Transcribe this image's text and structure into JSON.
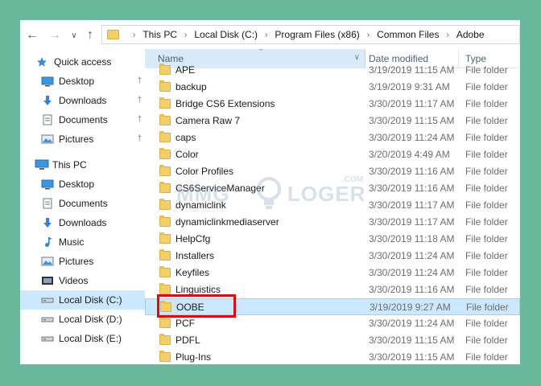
{
  "address": {
    "crumbs": [
      "This PC",
      "Local Disk (C:)",
      "Program Files (x86)",
      "Common Files",
      "Adobe"
    ]
  },
  "sidebar": {
    "items": [
      {
        "label": "Quick access",
        "icon": "star-icon",
        "pinned": false
      },
      {
        "label": "Desktop",
        "icon": "desktop-icon",
        "pinned": true
      },
      {
        "label": "Downloads",
        "icon": "download-icon",
        "pinned": true
      },
      {
        "label": "Documents",
        "icon": "document-icon",
        "pinned": true
      },
      {
        "label": "Pictures",
        "icon": "pictures-icon",
        "pinned": true
      },
      {
        "label": "This PC",
        "icon": "computer-icon",
        "pinned": false
      },
      {
        "label": "Desktop",
        "icon": "desktop-icon",
        "pinned": false
      },
      {
        "label": "Documents",
        "icon": "document-icon",
        "pinned": false
      },
      {
        "label": "Downloads",
        "icon": "download-icon",
        "pinned": false
      },
      {
        "label": "Music",
        "icon": "music-icon",
        "pinned": false
      },
      {
        "label": "Pictures",
        "icon": "pictures-icon",
        "pinned": false
      },
      {
        "label": "Videos",
        "icon": "video-icon",
        "pinned": false
      },
      {
        "label": "Local Disk (C:)",
        "icon": "drive-icon",
        "pinned": false
      },
      {
        "label": "Local Disk (D:)",
        "icon": "drive-icon",
        "pinned": false
      },
      {
        "label": "Local Disk (E:)",
        "icon": "drive-icon",
        "pinned": false
      }
    ],
    "selected_index": 12
  },
  "columns": {
    "name": "Name",
    "date": "Date modified",
    "type": "Type"
  },
  "files": [
    {
      "name": "APE",
      "date": "3/19/2019 11:15 AM",
      "type": "File folder"
    },
    {
      "name": "backup",
      "date": "3/19/2019 9:31 AM",
      "type": "File folder"
    },
    {
      "name": "Bridge CS6 Extensions",
      "date": "3/30/2019 11:17 AM",
      "type": "File folder"
    },
    {
      "name": "Camera Raw 7",
      "date": "3/30/2019 11:15 AM",
      "type": "File folder"
    },
    {
      "name": "caps",
      "date": "3/30/2019 11:24 AM",
      "type": "File folder"
    },
    {
      "name": "Color",
      "date": "3/20/2019 4:49 AM",
      "type": "File folder"
    },
    {
      "name": "Color Profiles",
      "date": "3/30/2019 11:16 AM",
      "type": "File folder"
    },
    {
      "name": "CS6ServiceManager",
      "date": "3/30/2019 11:16 AM",
      "type": "File folder"
    },
    {
      "name": "dynamiclink",
      "date": "3/30/2019 11:17 AM",
      "type": "File folder"
    },
    {
      "name": "dynamiclinkmediaserver",
      "date": "3/30/2019 11:17 AM",
      "type": "File folder"
    },
    {
      "name": "HelpCfg",
      "date": "3/30/2019 11:18 AM",
      "type": "File folder"
    },
    {
      "name": "Installers",
      "date": "3/30/2019 11:24 AM",
      "type": "File folder"
    },
    {
      "name": "Keyfiles",
      "date": "3/30/2019 11:24 AM",
      "type": "File folder"
    },
    {
      "name": "Linguistics",
      "date": "3/30/2019 11:16 AM",
      "type": "File folder"
    },
    {
      "name": "OOBE",
      "date": "3/19/2019 9:27 AM",
      "type": "File folder"
    },
    {
      "name": "PCF",
      "date": "3/30/2019 11:24 AM",
      "type": "File folder"
    },
    {
      "name": "PDFL",
      "date": "3/30/2019 11:15 AM",
      "type": "File folder"
    },
    {
      "name": "Plug-Ins",
      "date": "3/30/2019 11:15 AM",
      "type": "File folder"
    }
  ],
  "selected_file_index": 14,
  "watermark": {
    "left": "MMG",
    "right": "LOGER",
    "suffix": ".COM"
  },
  "colors": {
    "background": "#6bb89c",
    "selection": "#cce8ff",
    "highlight_box": "#d20f14"
  }
}
